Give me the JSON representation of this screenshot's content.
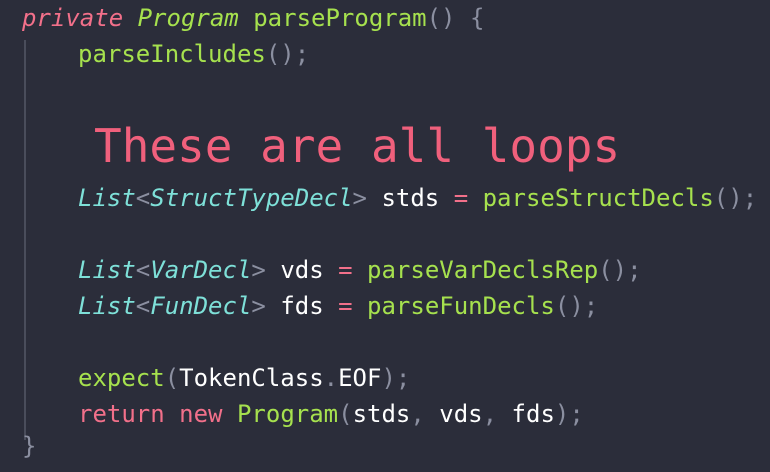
{
  "code": {
    "l1": {
      "kw": "private",
      "cls": "Program",
      "fn": "parseProgram",
      "paren": "()",
      "brace": "{"
    },
    "l2": {
      "fn": "parseIncludes",
      "paren": "()",
      "semi": ";"
    },
    "l4": {
      "type": "List",
      "lt": "<",
      "gen": "StructTypeDecl",
      "gt": ">",
      "var": "stds",
      "eq": "=",
      "fn": "parseStructDecls",
      "paren": "()",
      "semi": ";"
    },
    "l6": {
      "type": "List",
      "lt": "<",
      "gen": "VarDecl",
      "gt": ">",
      "var": "vds",
      "eq": "=",
      "fn": "parseVarDeclsRep",
      "paren": "()",
      "semi": ";"
    },
    "l7": {
      "type": "List",
      "lt": "<",
      "gen": "FunDecl",
      "gt": ">",
      "var": "fds",
      "eq": "=",
      "fn": "parseFunDecls",
      "paren": "()",
      "semi": ";"
    },
    "l9": {
      "fn": "expect",
      "open": "(",
      "arg": "TokenClass",
      "dot": ".",
      "member": "EOF",
      "close": ")",
      "semi": ";"
    },
    "l10": {
      "ret": "return",
      "new": "new",
      "cls": "Program",
      "open": "(",
      "a1": "stds",
      "c1": ",",
      "a2": "vds",
      "c2": ",",
      "a3": "fds",
      "close": ")",
      "semi": ";"
    },
    "l11": {
      "brace": "}"
    }
  },
  "annotation": "These are all loops",
  "colors": {
    "background": "#2b2d3a",
    "keyword": "#f2708a",
    "function": "#a6e14e",
    "type": "#7ee0d8",
    "punctuation": "#8b8fa0",
    "annotation": "#f0607c"
  }
}
